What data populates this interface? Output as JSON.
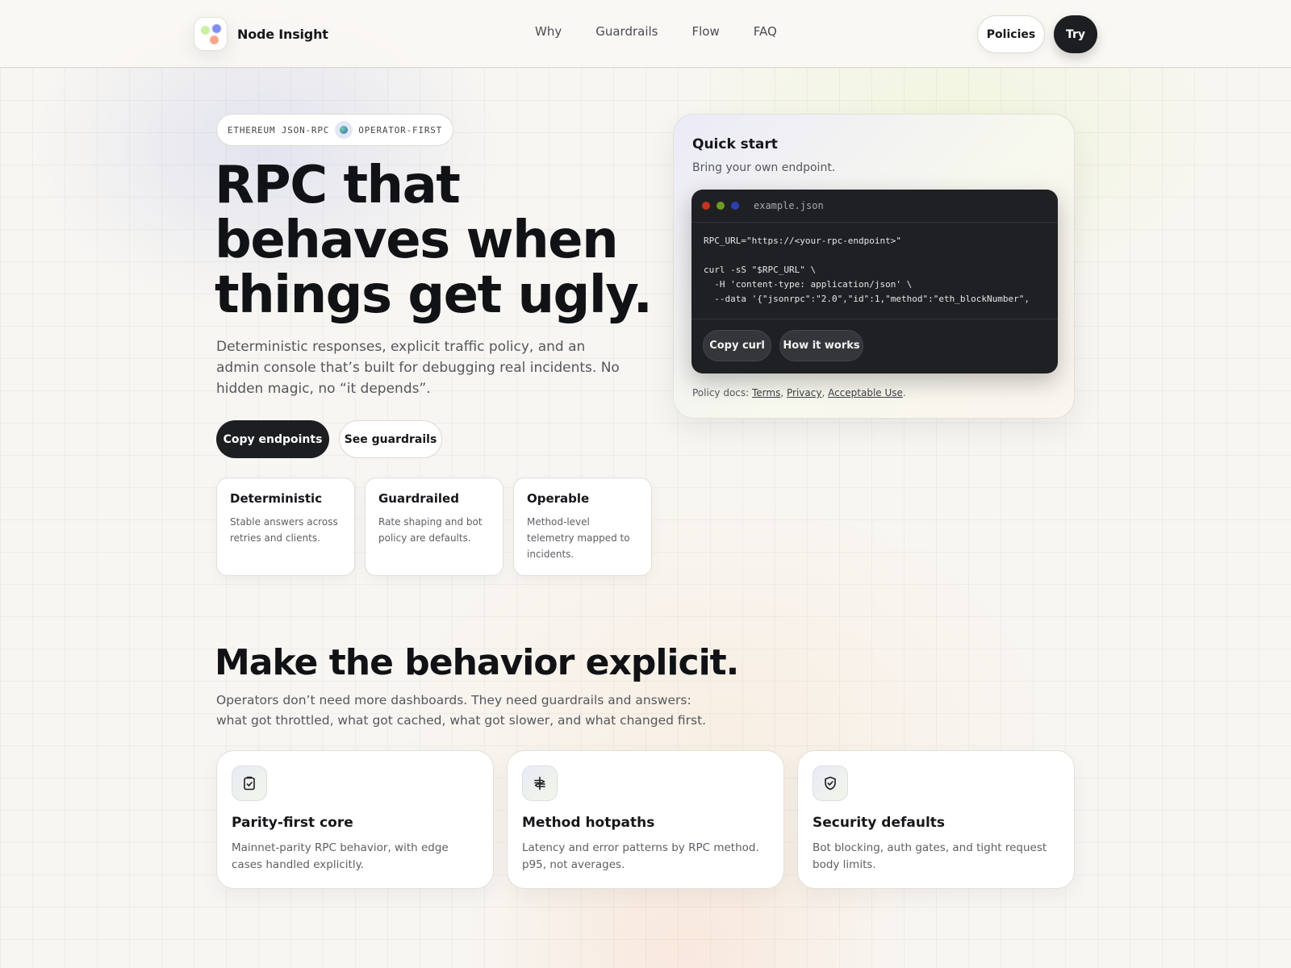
{
  "header": {
    "brand": "Node Insight",
    "nav": [
      "Why",
      "Guardrails",
      "Flow",
      "FAQ"
    ],
    "policies_label": "Policies",
    "try_label": "Try"
  },
  "hero": {
    "pill_left": "ETHEREUM JSON-RPC",
    "pill_right": "OPERATOR-FIRST",
    "title": "RPC that behaves when things get ugly.",
    "subtitle": "Deterministic responses, explicit traffic policy, and an admin console that’s built for debugging real incidents. No hidden magic, no “it depends”.",
    "cta_primary": "Copy endpoints",
    "cta_secondary": "See guardrails",
    "cards": [
      {
        "title": "Deterministic",
        "text": "Stable answers across retries and clients."
      },
      {
        "title": "Guardrailed",
        "text": "Rate shaping and bot policy are defaults."
      },
      {
        "title": "Operable",
        "text": "Method-level telemetry mapped to incidents."
      }
    ]
  },
  "quickstart": {
    "title": "Quick start",
    "subtitle": "Bring your own endpoint.",
    "filename": "example.json",
    "code": "RPC_URL=\"https://<your-rpc-endpoint>\"\n\ncurl -sS \"$RPC_URL\" \\\n  -H 'content-type: application/json' \\\n  --data '{\"jsonrpc\":\"2.0\",\"id\":1,\"method\":\"eth_blockNumber\",",
    "copy_label": "Copy curl",
    "how_label": "How it works",
    "footer_prefix": "Policy docs: ",
    "links": [
      "Terms",
      "Privacy",
      "Acceptable Use"
    ],
    "traffic_colors": [
      "#c5341e",
      "#6f9a22",
      "#2a3fb0"
    ]
  },
  "section": {
    "title": "Make the behavior explicit.",
    "subtitle": "Operators don’t need more dashboards. They need guardrails and answers: what got throttled, what got cached, what got slower, and what changed first.",
    "features": [
      {
        "icon": "checklist-icon",
        "title": "Parity-first core",
        "text": "Mainnet-parity RPC behavior, with edge cases handled explicitly."
      },
      {
        "icon": "signpost-icon",
        "title": "Method hotpaths",
        "text": "Latency and error patterns by RPC method. p95, not averages."
      },
      {
        "icon": "shield-check-icon",
        "title": "Security defaults",
        "text": "Bot blocking, auth gates, and tight request body limits."
      }
    ]
  }
}
